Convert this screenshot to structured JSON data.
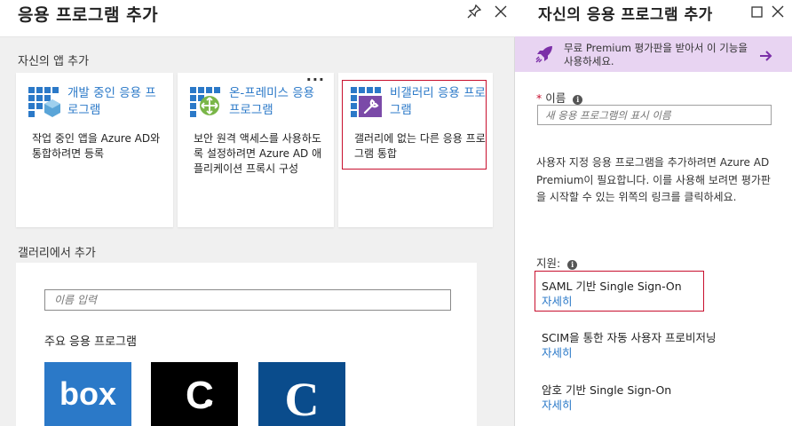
{
  "left_blade": {
    "title": "응용 프로그램 추가",
    "own_apps_label": "자신의 앱 추가",
    "tiles": [
      {
        "title": "개발 중인 응용 프로그램",
        "description": "작업 중인 앱을 Azure AD와 통합하려면 등록"
      },
      {
        "title": "온-프레미스 응용 프로그램",
        "description": "보안 원격 액세스를 사용하도록 설정하려면 Azure AD 애플리케이션 프록시 구성"
      },
      {
        "title": "비갤러리 응용 프로그램",
        "description": "갤러리에 없는 다른 응용 프로그램 통합"
      }
    ],
    "gallery_label": "갤러리에서 추가",
    "gallery_search_placeholder": "이름 입력",
    "featured_label": "주요 응용 프로그램",
    "featured_apps": [
      {
        "logo_text": "box",
        "bg": "#2b79c8",
        "icon": "box-logo"
      },
      {
        "logo_text": "C",
        "bg": "#000000",
        "icon": "concur-logo"
      },
      {
        "logo_text": "C",
        "bg": "#0a4c8c",
        "icon": "cornerstone-logo"
      }
    ]
  },
  "right_blade": {
    "title": "자신의 응용 프로그램 추가",
    "premium_banner": "무료 Premium 평가판을 받아서 이 기능을 사용하세요.",
    "name_label": "이름",
    "name_required_mark": "*",
    "name_placeholder": "새 응용 프로그램의 표시 이름",
    "description": "사용자 지정 응용 프로그램을 추가하려면 Azure AD Premium이 필요합니다. 이를 사용해 보려면 평가판을 시작할 수 있는 위쪽의 링크를 클릭하세요.",
    "support_label": "지원:",
    "support_items": [
      {
        "name": "SAML 기반 Single Sign-On",
        "link": "자세히"
      },
      {
        "name": "SCIM을 통한 자동 사용자 프로비저닝",
        "link": "자세히"
      },
      {
        "name": "암호 기반 Single Sign-On",
        "link": "자세히"
      }
    ]
  },
  "colors": {
    "accent": "#2b79c8",
    "highlight": "#c8102e",
    "premium_banner": "#e8d4f2",
    "premium_arrow": "#7b2fa8"
  }
}
